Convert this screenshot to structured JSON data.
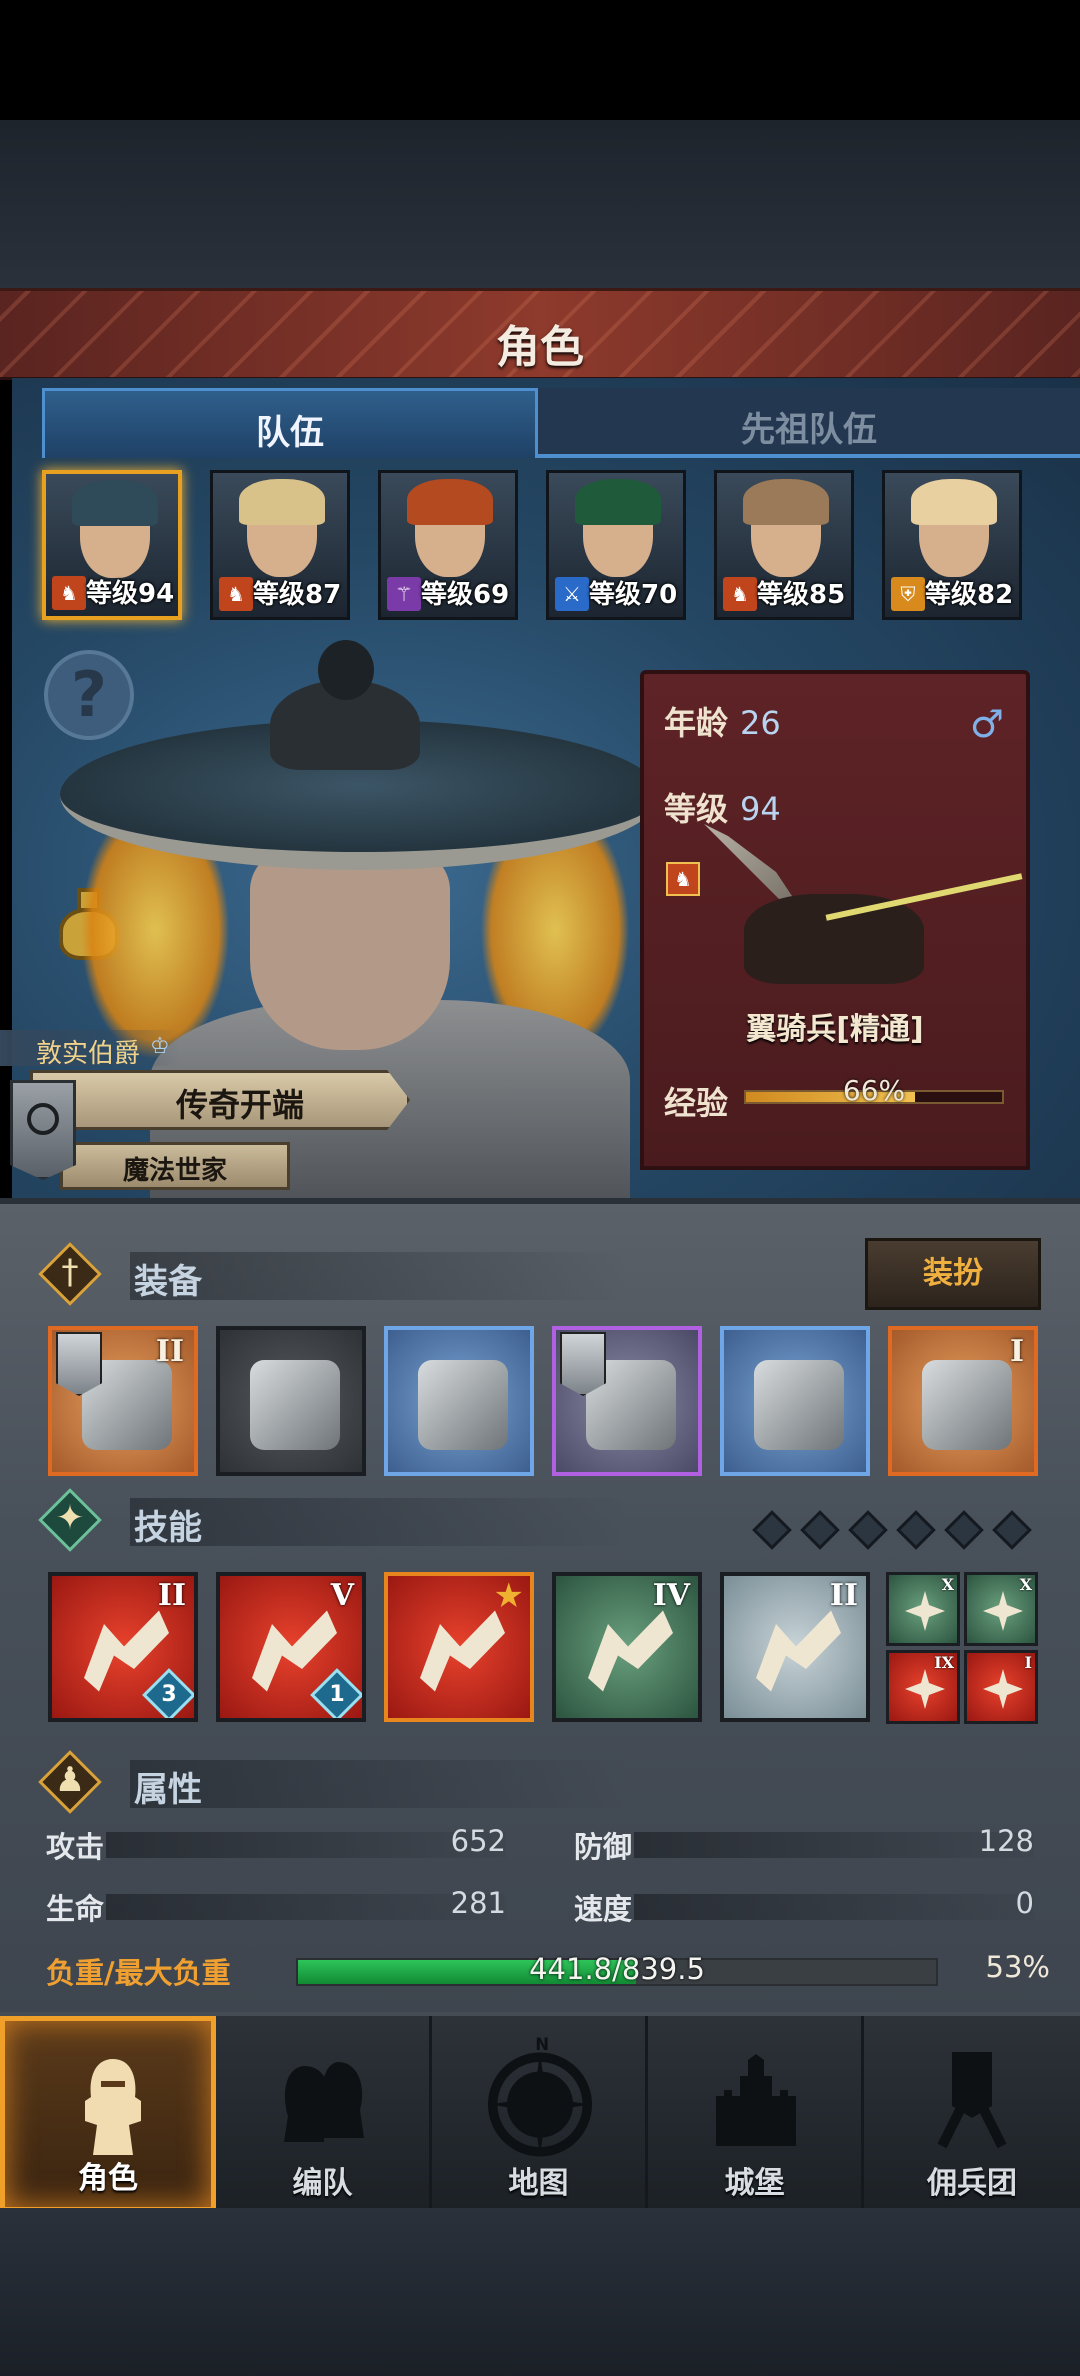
{
  "header": {
    "title": "角色"
  },
  "tabs": [
    {
      "label": "队伍",
      "active": true
    },
    {
      "label": "先祖队伍",
      "active": false
    }
  ],
  "party": [
    {
      "level_text": "等级94",
      "class_icon": "rider-icon",
      "class_color": "#c0441c",
      "hair": "#2f4a58",
      "selected": true
    },
    {
      "level_text": "等级87",
      "class_icon": "rider-icon",
      "class_color": "#c0441c",
      "hair": "#d8c28a",
      "selected": false
    },
    {
      "level_text": "等级69",
      "class_icon": "staff-icon",
      "class_color": "#7a3aa8",
      "hair": "#b44a20",
      "selected": false
    },
    {
      "level_text": "等级70",
      "class_icon": "sword-icon",
      "class_color": "#2a6ac8",
      "hair": "#1f5a3a",
      "selected": false
    },
    {
      "level_text": "等级85",
      "class_icon": "rider-icon",
      "class_color": "#c0441c",
      "hair": "#9a7a58",
      "selected": false
    },
    {
      "level_text": "等级82",
      "class_icon": "shield-icon",
      "class_color": "#d88a1c",
      "hair": "#e8d0a0",
      "selected": false
    }
  ],
  "hero": {
    "noble_title": "敦实伯爵",
    "legend_title": "传奇开端",
    "family": "魔法世家"
  },
  "info_card": {
    "age_label": "年龄",
    "age": "26",
    "level_label": "等级",
    "level": "94",
    "gender_icon": "male-icon",
    "unit_name": "翼骑兵[精通]",
    "xp_label": "经验",
    "xp_text": "66%",
    "xp_fraction": 0.66
  },
  "equipment": {
    "label": "装备",
    "outfit_label": "装扮",
    "slots": [
      {
        "name": "weapon-slot",
        "rarity": "orange",
        "tier": "II",
        "flag": true
      },
      {
        "name": "offhand-slot",
        "rarity": "gray",
        "tier": "",
        "flag": false
      },
      {
        "name": "helmet-slot",
        "rarity": "blue",
        "tier": "",
        "flag": false
      },
      {
        "name": "armor-slot",
        "rarity": "purple",
        "tier": "",
        "flag": true
      },
      {
        "name": "boots-slot",
        "rarity": "blue",
        "tier": "",
        "flag": false
      },
      {
        "name": "accessory-slot",
        "rarity": "orange",
        "tier": "I",
        "flag": false
      }
    ]
  },
  "skills": {
    "label": "技能",
    "slots": [
      {
        "color": "red",
        "tier": "II",
        "gem": "3",
        "star": false
      },
      {
        "color": "red",
        "tier": "V",
        "gem": "1",
        "star": false
      },
      {
        "color": "red",
        "tier": "",
        "gem": "",
        "star": true
      },
      {
        "color": "green",
        "tier": "IV",
        "gem": "",
        "star": false
      },
      {
        "color": "pale",
        "tier": "II",
        "gem": "",
        "star": false
      }
    ],
    "mini": [
      {
        "color": "green",
        "tier": "X"
      },
      {
        "color": "green",
        "tier": "X"
      },
      {
        "color": "red",
        "tier": "IX"
      },
      {
        "color": "red",
        "tier": "I"
      }
    ]
  },
  "attributes": {
    "label": "属性",
    "attack_label": "攻击",
    "attack": "652",
    "defense_label": "防御",
    "defense": "128",
    "hp_label": "生命",
    "hp": "281",
    "speed_label": "速度",
    "speed": "0",
    "load_label": "负重/最大负重",
    "load_text": "441.8/839.5",
    "load_pct": "53%",
    "load_fraction": 0.53
  },
  "nav": [
    {
      "label": "角色",
      "active": true
    },
    {
      "label": "编队",
      "active": false
    },
    {
      "label": "地图",
      "active": false
    },
    {
      "label": "城堡",
      "active": false
    },
    {
      "label": "佣兵团",
      "active": false
    }
  ]
}
